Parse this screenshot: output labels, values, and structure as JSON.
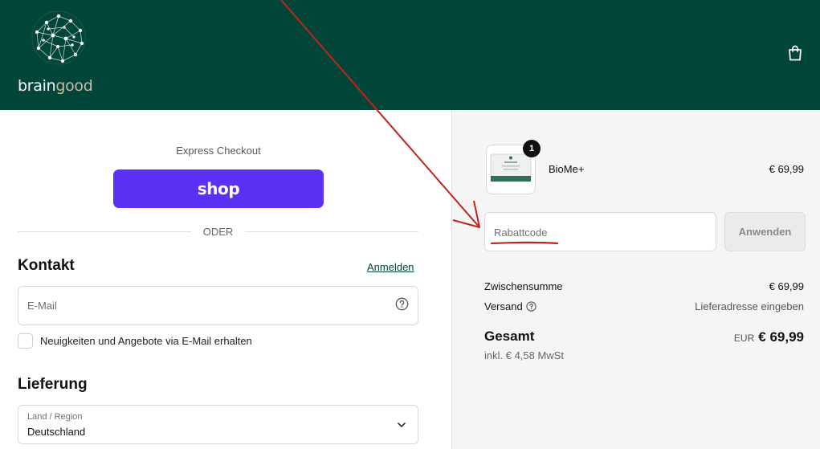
{
  "brand": {
    "name_part1": "brain",
    "name_part2": "good"
  },
  "express": {
    "label": "Express Checkout",
    "shop_label": "shop"
  },
  "separator": "ODER",
  "contact": {
    "heading": "Kontakt",
    "login_link": "Anmelden",
    "email_placeholder": "E-Mail",
    "newsletter_label": "Neuigkeiten und Angebote via E-Mail erhalten"
  },
  "delivery": {
    "heading": "Lieferung",
    "country_label": "Land / Region",
    "country_value": "Deutschland"
  },
  "order": {
    "items": [
      {
        "name": "BioMe+",
        "price": "€ 69,99",
        "quantity": "1"
      }
    ],
    "discount_placeholder": "Rabattcode",
    "apply_label": "Anwenden",
    "subtotal_label": "Zwischensumme",
    "subtotal_value": "€ 69,99",
    "shipping_label": "Versand",
    "shipping_value": "Lieferadresse eingeben",
    "total_label": "Gesamt",
    "total_currency": "EUR",
    "total_value": "€ 69,99",
    "tax_note": "inkl. € 4,58 MwSt"
  },
  "colors": {
    "header_bg": "#02463a",
    "shop_button": "#5a31f4",
    "annotation": "#c0241c"
  },
  "icons": {
    "cart": "shopping-bag-icon",
    "help": "question-circle-icon",
    "select": "chevron-down-icon"
  }
}
